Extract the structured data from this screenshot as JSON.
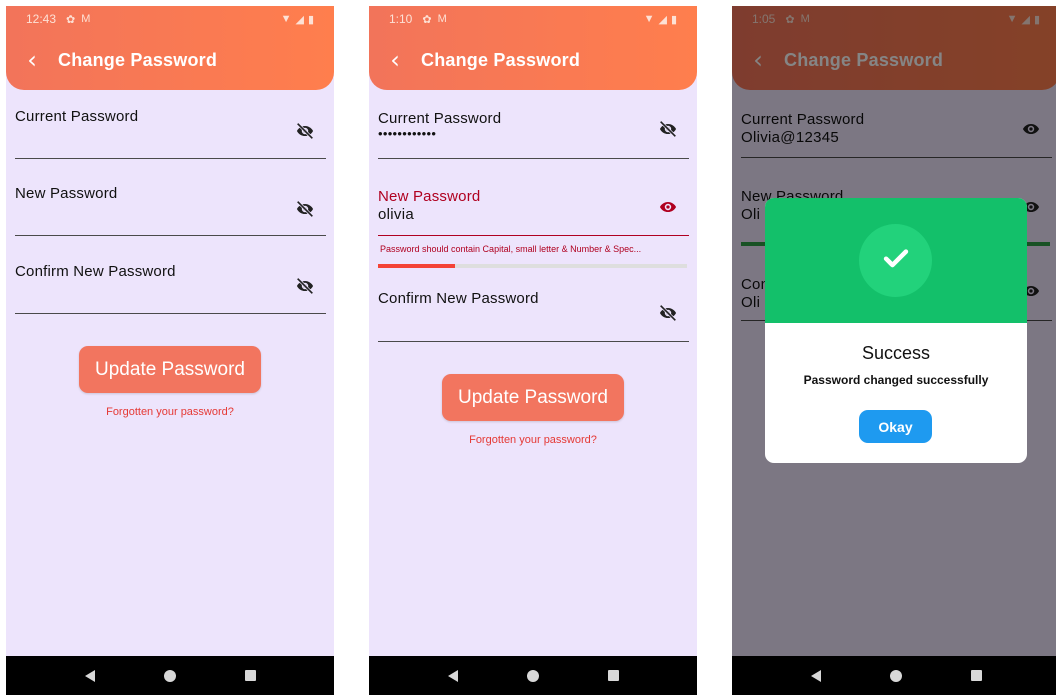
{
  "screens": [
    {
      "status": {
        "time": "12:43"
      },
      "title": "Change Password",
      "fields": [
        {
          "label": "Current Password",
          "value": ""
        },
        {
          "label": "New Password",
          "value": ""
        },
        {
          "label": "Confirm New Password",
          "value": ""
        }
      ],
      "update_button": "Update Password",
      "forgot_link": "Forgotten your password?"
    },
    {
      "status": {
        "time": "1:10"
      },
      "title": "Change Password",
      "fields": [
        {
          "label": "Current Password",
          "value": "••••••••••••"
        },
        {
          "label": "New Password",
          "value": "olivia",
          "error": "Password should contain Capital, small letter & Number & Spec..."
        },
        {
          "label": "Confirm New Password",
          "value": ""
        }
      ],
      "password_strength": 0.25,
      "update_button": "Update Password",
      "forgot_link": "Forgotten your password?"
    },
    {
      "status": {
        "time": "1:05"
      },
      "title": "Change Password",
      "fields": [
        {
          "label": "Current Password",
          "value": "Olivia@12345"
        },
        {
          "label": "New Password",
          "value": "Oli"
        },
        {
          "label": "Con",
          "value": "Oli"
        }
      ],
      "dialog": {
        "title": "Success",
        "message": "Password changed successfully",
        "button": "Okay"
      }
    }
  ],
  "colors": {
    "appbar": "#f2745a",
    "background": "#ede4fc",
    "button": "#f2755f",
    "error": "#b00020",
    "link": "#e53935",
    "success": "#13c06a",
    "okay": "#1e9af0"
  },
  "icons": {
    "status": [
      "gear-icon",
      "gmail-icon",
      "wifi-icon",
      "signal-icon",
      "battery-icon"
    ],
    "visibility_off": "eye-off-icon",
    "visibility_on": "eye-icon",
    "check": "check-icon"
  }
}
